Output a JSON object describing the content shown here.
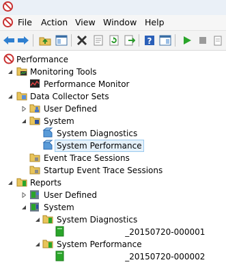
{
  "menu": {
    "items": [
      "File",
      "Action",
      "View",
      "Window",
      "Help"
    ]
  },
  "toolbar": {
    "icons": [
      "back-arrow-icon",
      "forward-arrow-icon",
      "up-folder-icon",
      "show-hide-tree-icon",
      "delete-icon",
      "properties-icon",
      "refresh-icon",
      "export-list-icon",
      "help-icon",
      "show-hide-action-pane-icon",
      "start-icon",
      "stop-icon",
      "new-icon"
    ]
  },
  "tree": {
    "root": "Performance",
    "monitoring_tools": "Monitoring Tools",
    "performance_monitor": "Performance Monitor",
    "data_collector_sets": "Data Collector Sets",
    "dcs_user_defined": "User Defined",
    "dcs_system": "System",
    "system_diagnostics": "System Diagnostics",
    "system_performance": "System Performance",
    "event_trace_sessions": "Event Trace Sessions",
    "startup_event_trace_sessions": "Startup Event Trace Sessions",
    "reports": "Reports",
    "rep_user_defined": "User Defined",
    "rep_system": "System",
    "rep_system_diagnostics": "System Diagnostics",
    "rep_diag_report": "_20150720-000001",
    "rep_system_performance": "System Performance",
    "rep_perf_report": "_20150720-000002"
  },
  "colors": {
    "selection_bg": "#e5f1fb",
    "selection_border": "#99c9ef",
    "accent_red": "#c83030",
    "start_green": "#2aa52a"
  }
}
